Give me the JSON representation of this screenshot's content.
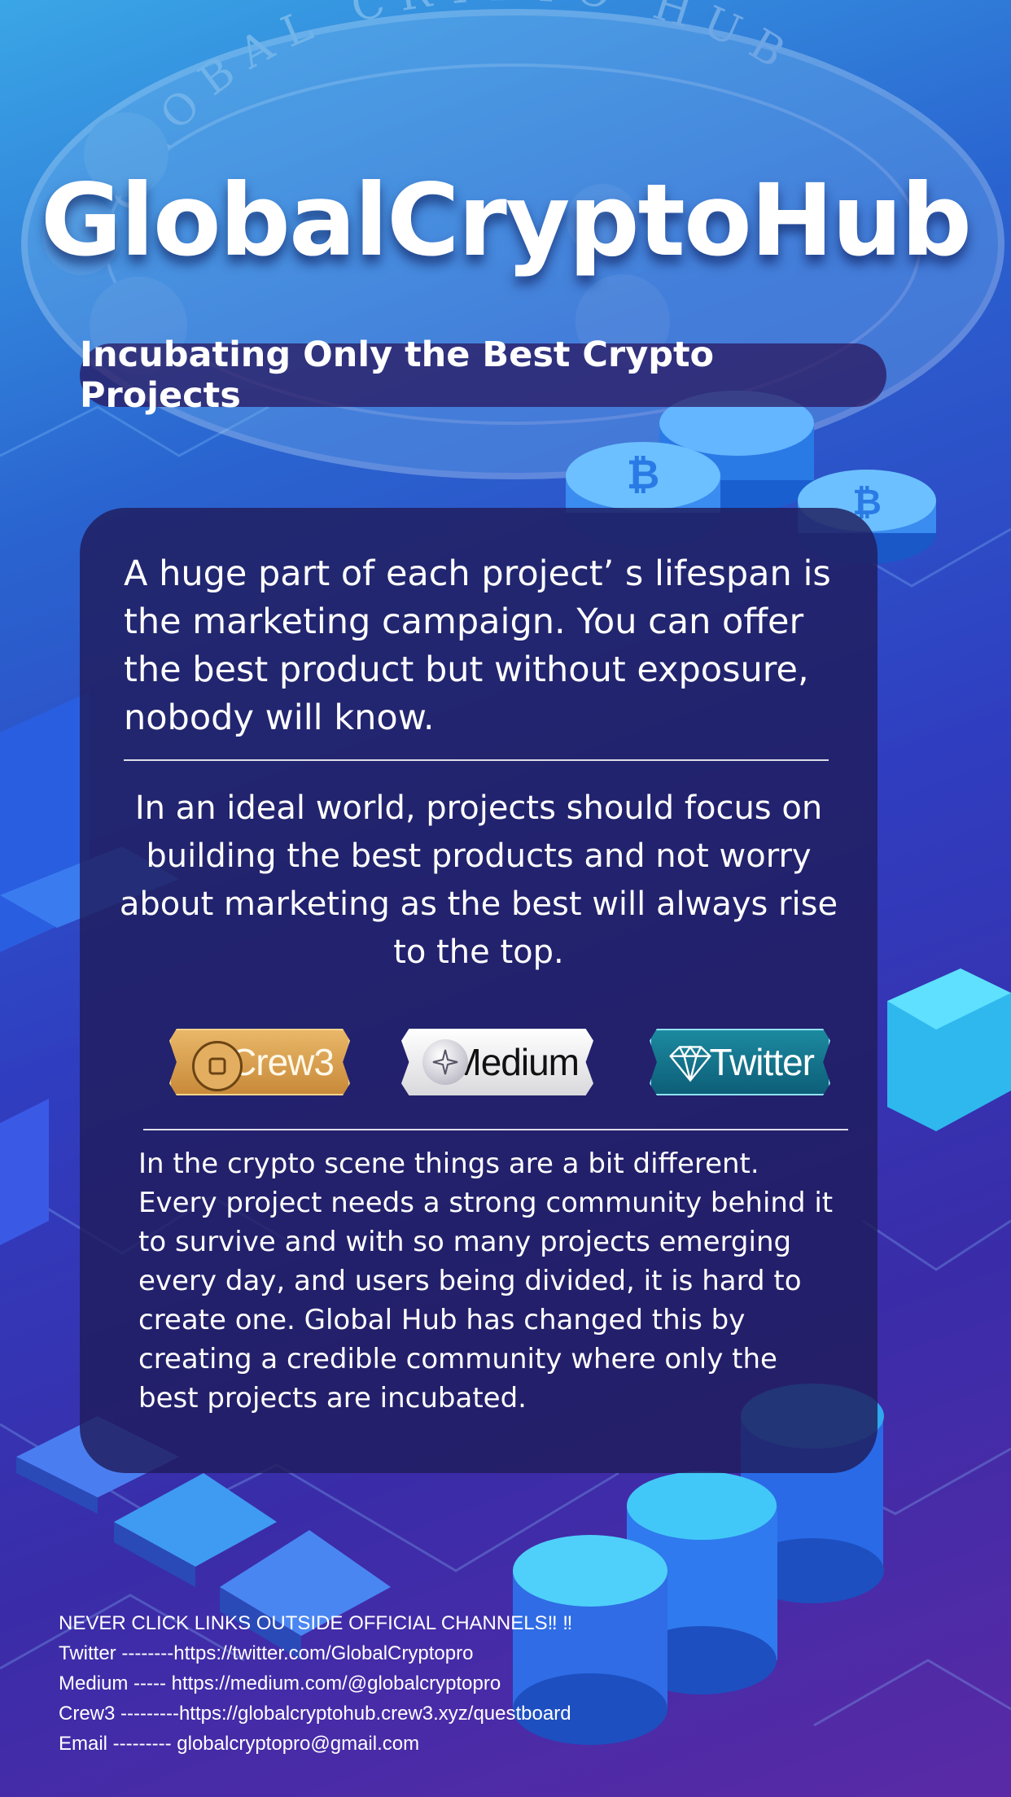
{
  "header": {
    "seal_text": "GLOBAL CRYPTO HUB",
    "title": "GlobalCryptoHub",
    "subtitle": "Incubating Only the Best Crypto Projects"
  },
  "card": {
    "para1": "A huge part of each project’ s lifespan is the marketing campaign. You can offer the best product but without exposure, nobody will know.",
    "para2": "In an ideal world, projects should focus on building the best products and not worry about marketing as the best will always rise to the top.",
    "buttons": [
      {
        "label": "Crew3",
        "icon": "square-coin-icon"
      },
      {
        "label": "Medium",
        "icon": "star-icon"
      },
      {
        "label": "Twitter",
        "icon": "diamond-icon"
      }
    ],
    "para3": "In the crypto scene things are a bit different. Every project needs a strong community behind it to survive and with so many projects emerging every day, and users being divided, it is hard to create one. Global Hub has changed this by creating a credible community where only the best projects are incubated."
  },
  "footer": {
    "warning": "NEVER CLICK LINKS OUTSIDE OFFICIAL CHANNELS‼ ‼",
    "twitter": "Twitter --------https://twitter.com/GlobalCryptopro",
    "medium": "Medium -----  https://medium.com/@globalcryptopro",
    "crew3": "Crew3 ---------https://globalcryptohub.crew3.xyz/questboard",
    "email": "Email --------- globalcryptopro@gmail.com"
  },
  "colors": {
    "background_top": "#3aa6e6",
    "background_bottom": "#5a2aa6",
    "card": "#201c5c",
    "crew3": "#d9a050",
    "medium": "#eeeeee",
    "twitter": "#14748c"
  }
}
